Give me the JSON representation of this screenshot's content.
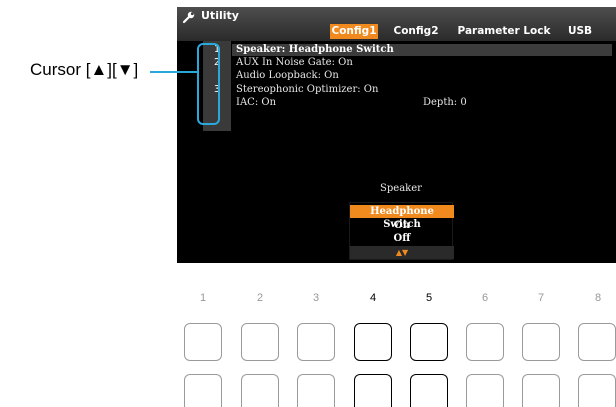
{
  "screen": {
    "title": "Utility",
    "tabs": [
      {
        "label": "Config1",
        "active": true
      },
      {
        "label": "Config2",
        "active": false
      },
      {
        "label": "Parameter Lock",
        "active": false
      },
      {
        "label": "USB",
        "active": false
      }
    ],
    "rows": [
      {
        "num": "1",
        "label": "Speaker: Headphone Switch",
        "selected": true
      },
      {
        "num": "2",
        "label": "AUX In Noise Gate: On"
      },
      {
        "num": "",
        "label": "Audio Loopback: On"
      },
      {
        "num": "3",
        "label": "Stereophonic Optimizer: On"
      },
      {
        "num": "",
        "label": "IAC: On",
        "extra": "Depth: 0"
      }
    ],
    "popup": {
      "title": "Speaker",
      "options": [
        "Headphone Switch",
        "On",
        "Off"
      ],
      "selected": "Headphone Switch",
      "arrows": "▲▼"
    },
    "accent_color": "#f08a1e"
  },
  "callout": {
    "label": "Cursor [▲][▼]",
    "color": "#2aa8dc"
  },
  "buttons": {
    "numbers": [
      "1",
      "2",
      "3",
      "4",
      "5",
      "6",
      "7",
      "8"
    ],
    "highlighted": [
      "4",
      "5"
    ]
  }
}
